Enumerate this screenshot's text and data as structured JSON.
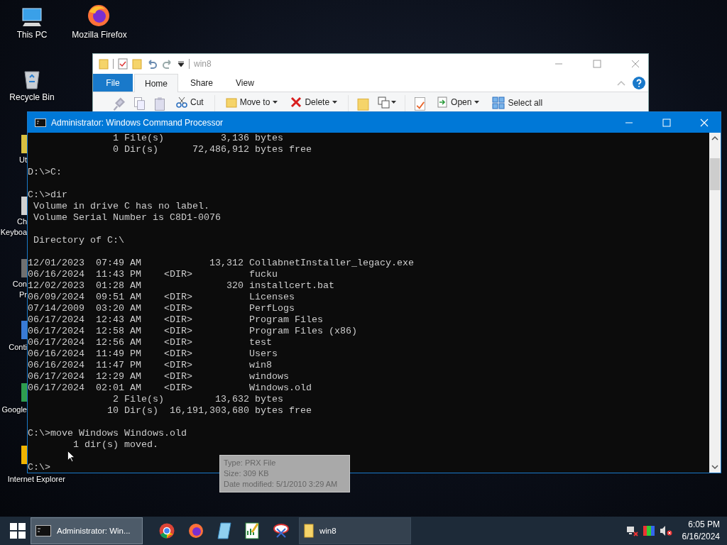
{
  "desktop_icons": [
    {
      "lines": [
        "This PC"
      ],
      "kind": "full"
    },
    {
      "lines": [
        "Mozilla Firefox"
      ],
      "kind": "full"
    },
    {
      "lines": [
        "Recycle Bin"
      ],
      "kind": "full"
    },
    {
      "lines": [
        "Ut"
      ],
      "kind": "cut"
    },
    {
      "lines": [
        "Ch",
        "Keyboa"
      ],
      "kind": "cut"
    },
    {
      "lines": [
        "Con",
        "Pr"
      ],
      "kind": "cut"
    },
    {
      "lines": [
        "Conti"
      ],
      "kind": "cut"
    },
    {
      "lines": [
        "Google"
      ],
      "kind": "cut"
    },
    {
      "lines": [
        "Internet Explorer"
      ],
      "kind": "cut"
    }
  ],
  "explorer": {
    "title": "win8",
    "file_tab": "File",
    "tabs": [
      {
        "label": "Home",
        "selected": true
      },
      {
        "label": "Share",
        "selected": false
      },
      {
        "label": "View",
        "selected": false
      }
    ],
    "ribbon": [
      {
        "label": "Cut",
        "kind": "cut"
      },
      {
        "label": "Move to",
        "kind": "move"
      },
      {
        "label": "Delete",
        "kind": "delete"
      },
      {
        "label": "Open",
        "kind": "open"
      },
      {
        "label": "Select all",
        "kind": "select"
      }
    ]
  },
  "console": {
    "title": "Administrator: Windows Command Processor",
    "blocks": [
      [
        "               1 File(s)          3,136 bytes",
        "               0 Dir(s)      72,486,912 bytes free"
      ],
      [
        "D:\\>C:"
      ],
      [
        "C:\\>dir",
        " Volume in drive C has no label.",
        " Volume Serial Number is C8D1-0076"
      ],
      [
        " Directory of C:\\"
      ],
      [
        "12/01/2023  07:49 AM            13,312 CollabnetInstaller_legacy.exe",
        "06/16/2024  11:43 PM    <DIR>          fucku",
        "12/02/2023  01:28 AM               320 installcert.bat",
        "06/09/2024  09:51 AM    <DIR>          Licenses",
        "07/14/2009  03:20 AM    <DIR>          PerfLogs",
        "06/17/2024  12:43 AM    <DIR>          Program Files",
        "06/17/2024  12:58 AM    <DIR>          Program Files (x86)",
        "06/17/2024  12:56 AM    <DIR>          test",
        "06/16/2024  11:49 PM    <DIR>          Users",
        "06/16/2024  11:47 PM    <DIR>          win8",
        "06/17/2024  12:29 AM    <DIR>          windows",
        "06/17/2024  02:01 AM    <DIR>          Windows.old",
        "               2 File(s)         13,632 bytes",
        "              10 Dir(s)  16,191,303,680 bytes free"
      ],
      [
        "C:\\>move Windows Windows.old",
        "        1 dir(s) moved."
      ],
      [
        "C:\\>"
      ]
    ]
  },
  "tooltip": {
    "lines": [
      "Type: PRX File",
      "Size: 309 KB",
      "Date modified: 5/1/2010 3:29 AM"
    ]
  },
  "taskbar": {
    "items": [
      {
        "kind": "console",
        "label": "Administrator: Win...",
        "active": true
      },
      {
        "kind": "chrome"
      },
      {
        "kind": "firefox"
      },
      {
        "kind": "notepad"
      },
      {
        "kind": "chart"
      },
      {
        "kind": "snip"
      },
      {
        "kind": "folder",
        "label": "win8",
        "active": false
      }
    ]
  },
  "clock": {
    "time": "6:05 PM",
    "date": "6/16/2024"
  }
}
